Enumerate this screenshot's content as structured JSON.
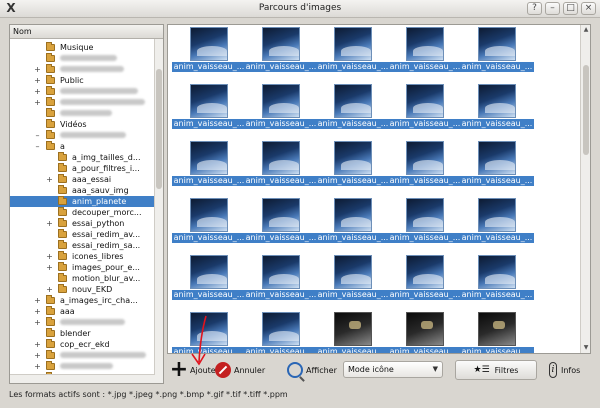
{
  "window": {
    "title": "Parcours d'images",
    "app_icon": "x-icon",
    "controls": [
      "?",
      "–",
      "□",
      "×"
    ]
  },
  "tree": {
    "header": "Nom",
    "rows": [
      {
        "label": "Musique",
        "indent": 1,
        "expander": "",
        "blurred": false
      },
      {
        "label": "",
        "indent": 1,
        "expander": "",
        "blurred": true
      },
      {
        "label": "",
        "indent": 1,
        "expander": "+",
        "blurred": true
      },
      {
        "label": "Public",
        "indent": 1,
        "expander": "+",
        "blurred": false
      },
      {
        "label": "",
        "indent": 1,
        "expander": "+",
        "blurred": true
      },
      {
        "label": "",
        "indent": 1,
        "expander": "+",
        "blurred": true
      },
      {
        "label": "",
        "indent": 1,
        "expander": "",
        "blurred": true
      },
      {
        "label": "Vidéos",
        "indent": 1,
        "expander": "",
        "blurred": false
      },
      {
        "label": "",
        "indent": 1,
        "expander": "–",
        "blurred": true
      },
      {
        "label": "a",
        "indent": 1,
        "expander": "–",
        "blurred": false
      },
      {
        "label": "a_img_tailles_d...",
        "indent": 2,
        "expander": "",
        "blurred": false
      },
      {
        "label": "a_pour_filtres_i...",
        "indent": 2,
        "expander": "",
        "blurred": false
      },
      {
        "label": "aaa_essai",
        "indent": 2,
        "expander": "+",
        "blurred": false
      },
      {
        "label": "aaa_sauv_img",
        "indent": 2,
        "expander": "",
        "blurred": false
      },
      {
        "label": "anim_planete",
        "indent": 2,
        "expander": "",
        "blurred": false,
        "selected": true
      },
      {
        "label": "decouper_morc...",
        "indent": 2,
        "expander": "",
        "blurred": false
      },
      {
        "label": "essai_python",
        "indent": 2,
        "expander": "+",
        "blurred": false
      },
      {
        "label": "essai_redim_av...",
        "indent": 2,
        "expander": "",
        "blurred": false
      },
      {
        "label": "essai_redim_sa...",
        "indent": 2,
        "expander": "",
        "blurred": false
      },
      {
        "label": "icones_libres",
        "indent": 2,
        "expander": "+",
        "blurred": false
      },
      {
        "label": "images_pour_e...",
        "indent": 2,
        "expander": "+",
        "blurred": false
      },
      {
        "label": "motion_blur_av...",
        "indent": 2,
        "expander": "",
        "blurred": false
      },
      {
        "label": "nouv_EKD",
        "indent": 2,
        "expander": "+",
        "blurred": false
      },
      {
        "label": "a_images_irc_cha...",
        "indent": 1,
        "expander": "+",
        "blurred": false
      },
      {
        "label": "aaa",
        "indent": 1,
        "expander": "+",
        "blurred": false
      },
      {
        "label": "",
        "indent": 1,
        "expander": "+",
        "blurred": true
      },
      {
        "label": "blender",
        "indent": 1,
        "expander": "",
        "blurred": false
      },
      {
        "label": "cop_ecr_ekd",
        "indent": 1,
        "expander": "+",
        "blurred": false
      },
      {
        "label": "",
        "indent": 1,
        "expander": "+",
        "blurred": true
      },
      {
        "label": "",
        "indent": 1,
        "expander": "+",
        "blurred": true
      },
      {
        "label": "divers",
        "indent": 1,
        "expander": "+",
        "blurred": false
      }
    ]
  },
  "grid": {
    "caption": "anim_vaisseau_...",
    "columns": 5,
    "rows": 6,
    "dark_cells": [
      27,
      28,
      29
    ]
  },
  "toolbar": {
    "add_label": "Ajouter",
    "cancel_label": "Annuler",
    "view_label": "Afficher",
    "mode_value": "Mode icône",
    "filters_label": "Filtres",
    "info_label": "Infos"
  },
  "status": {
    "text": "Les formats actifs sont : *.jpg *.jpeg *.png *.bmp *.gif *.tif *.tiff *.ppm"
  },
  "colors": {
    "selection": "#3f7fc7",
    "annotation": "#e0141e"
  }
}
